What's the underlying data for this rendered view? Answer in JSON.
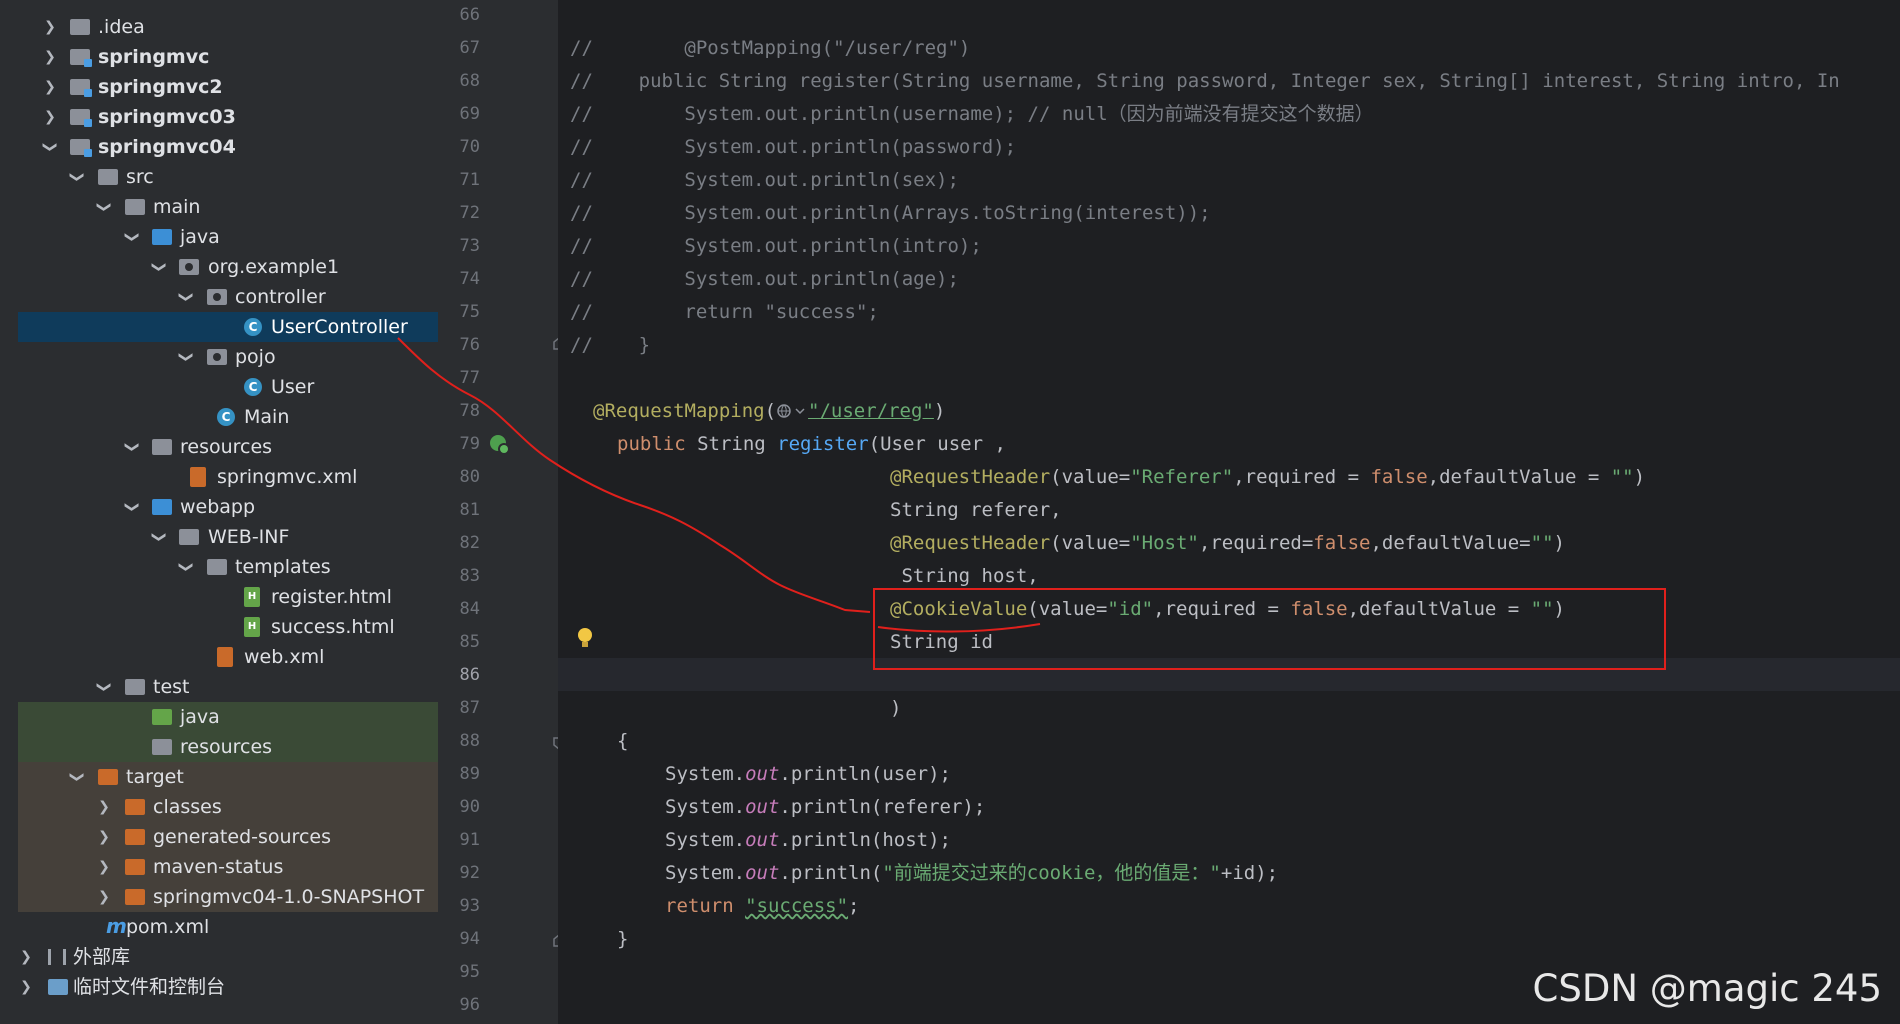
{
  "sidebar": {
    "items": [
      {
        "label": ".idea"
      },
      {
        "label": "springmvc"
      },
      {
        "label": "springmvc2"
      },
      {
        "label": "springmvc03"
      },
      {
        "label": "springmvc04"
      },
      {
        "label": "src"
      },
      {
        "label": "main"
      },
      {
        "label": "java"
      },
      {
        "label": "org.example1"
      },
      {
        "label": "controller"
      },
      {
        "label": "UserController"
      },
      {
        "label": "pojo"
      },
      {
        "label": "User"
      },
      {
        "label": "Main"
      },
      {
        "label": "resources"
      },
      {
        "label": "springmvc.xml"
      },
      {
        "label": "webapp"
      },
      {
        "label": "WEB-INF"
      },
      {
        "label": "templates"
      },
      {
        "label": "register.html"
      },
      {
        "label": "success.html"
      },
      {
        "label": "web.xml"
      },
      {
        "label": "test"
      },
      {
        "label": "java"
      },
      {
        "label": "resources"
      },
      {
        "label": "target"
      },
      {
        "label": "classes"
      },
      {
        "label": "generated-sources"
      },
      {
        "label": "maven-status"
      },
      {
        "label": "springmvc04-1.0-SNAPSHOT"
      },
      {
        "label": "pom.xml"
      },
      {
        "label": "外部库"
      },
      {
        "label": "临时文件和控制台"
      }
    ]
  },
  "editor": {
    "line_numbers": [
      "66",
      "67",
      "68",
      "69",
      "70",
      "71",
      "72",
      "73",
      "74",
      "75",
      "76",
      "77",
      "78",
      "79",
      "80",
      "81",
      "82",
      "83",
      "84",
      "85",
      "86",
      "87",
      "88",
      "89",
      "90",
      "91",
      "92",
      "93",
      "94",
      "95",
      "96"
    ],
    "current_line": "86",
    "lines": {
      "l67": "//        @PostMapping(\"/user/reg\")",
      "l68": "//    public String register(String username, String password, Integer sex, String[] interest, String intro, In",
      "l69": "//        System.out.println(username); // null（因为前端没有提交这个数据）",
      "l70": "//        System.out.println(password);",
      "l71": "//        System.out.println(sex);",
      "l72": "//        System.out.println(Arrays.toString(interest));",
      "l73": "//        System.out.println(intro);",
      "l74": "//        System.out.println(age);",
      "l75": "//        return \"success\";",
      "l76": "//    }",
      "l78_ann": "@RequestMapping",
      "l78_paren": "(",
      "l78_str": "\"/user/reg\"",
      "l78_close": ")",
      "l79_kw": "public ",
      "l79_type": "String ",
      "l79_fn": "register",
      "l79_rest": "(User user ,",
      "l80_ann": "@RequestHeader",
      "l80_a": "(value=",
      "l80_s1": "\"Referer\"",
      "l80_b": ",required = ",
      "l80_kw": "false",
      "l80_c": ",defaultValue = ",
      "l80_s2": "\"\"",
      "l80_d": ")",
      "l81": "String referer,",
      "l82_ann": "@RequestHeader",
      "l82_a": "(value=",
      "l82_s1": "\"Host\"",
      "l82_b": ",required=",
      "l82_kw": "false",
      "l82_c": ",defaultValue=",
      "l82_s2": "\"\"",
      "l82_d": ")",
      "l83": " String host,",
      "l84_ann": "@CookieValue",
      "l84_a": "(value=",
      "l84_s1": "\"id\"",
      "l84_b": ",required = ",
      "l84_kw": "false",
      "l84_c": ",defaultValue = ",
      "l84_s2": "\"\"",
      "l84_d": ")",
      "l85": "String id",
      "l87": ")",
      "l88": "{",
      "l89_a": "System.",
      "l89_fld": "out",
      "l89_b": ".println(user);",
      "l90_a": "System.",
      "l90_fld": "out",
      "l90_b": ".println(referer);",
      "l91_a": "System.",
      "l91_fld": "out",
      "l91_b": ".println(host);",
      "l92_a": "System.",
      "l92_fld": "out",
      "l92_b": ".println(",
      "l92_s": "\"前端提交过来的cookie，他的值是：\"",
      "l92_c": "+id);",
      "l93_kw": "return ",
      "l93_s": "\"success\"",
      "l93_end": ";",
      "l94": "}"
    }
  },
  "watermark": "CSDN @magic 245",
  "colors": {
    "annotation_box": "#e0201c",
    "selection": "#0f3b5b",
    "editor_bg": "#1e1f22"
  }
}
